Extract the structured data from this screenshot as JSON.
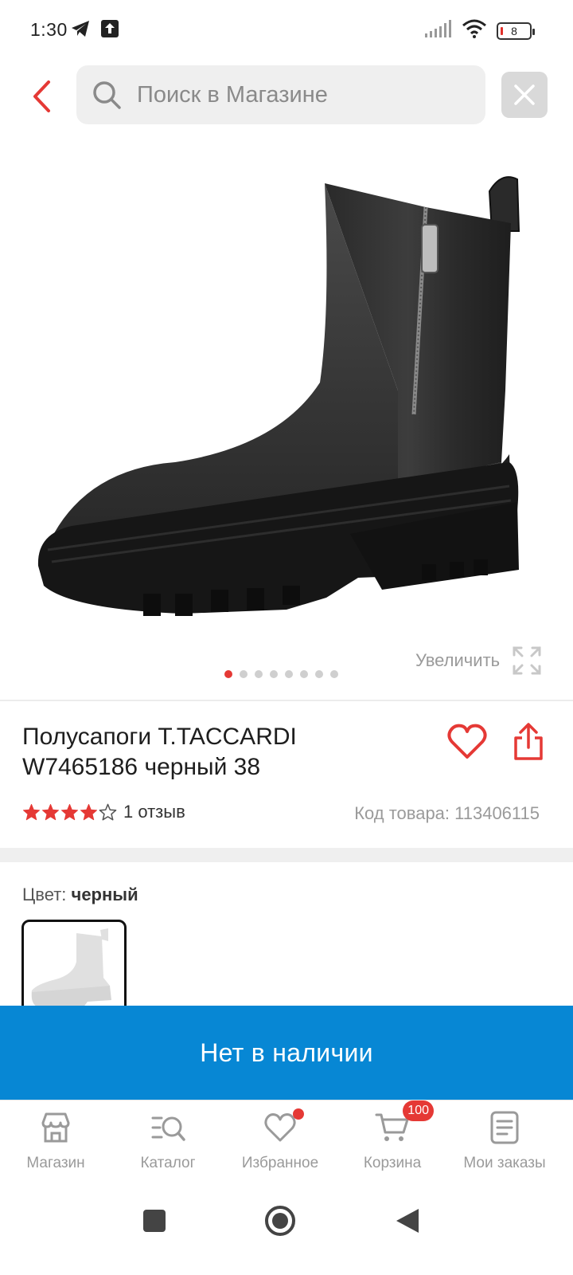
{
  "status_bar": {
    "time": "1:30",
    "battery": "8"
  },
  "search": {
    "placeholder": "Поиск в Магазине"
  },
  "gallery": {
    "zoom_label": "Увеличить",
    "dot_count": 8,
    "active_index": 0
  },
  "product": {
    "title_line1": "Полусапоги T.TACCARDI",
    "title_line2": "W7465186 черный 38",
    "rating": 4,
    "rating_max": 5,
    "reviews": "1 отзыв",
    "sku": "Код товара: 113406115"
  },
  "color": {
    "label": "Цвет:",
    "value": "черный"
  },
  "availability": {
    "button_label": "Нет в наличии"
  },
  "bottom_nav": {
    "items": [
      {
        "label": "Магазин",
        "icon": "store-icon"
      },
      {
        "label": "Каталог",
        "icon": "catalog-search-icon"
      },
      {
        "label": "Избранное",
        "icon": "heart-icon"
      },
      {
        "label": "Корзина",
        "icon": "cart-icon",
        "badge": "100"
      },
      {
        "label": "Мои заказы",
        "icon": "orders-icon"
      }
    ]
  },
  "colors": {
    "accent_red": "#e53935",
    "button_blue": "#0787d4",
    "muted_gray": "#9a9a9a"
  }
}
